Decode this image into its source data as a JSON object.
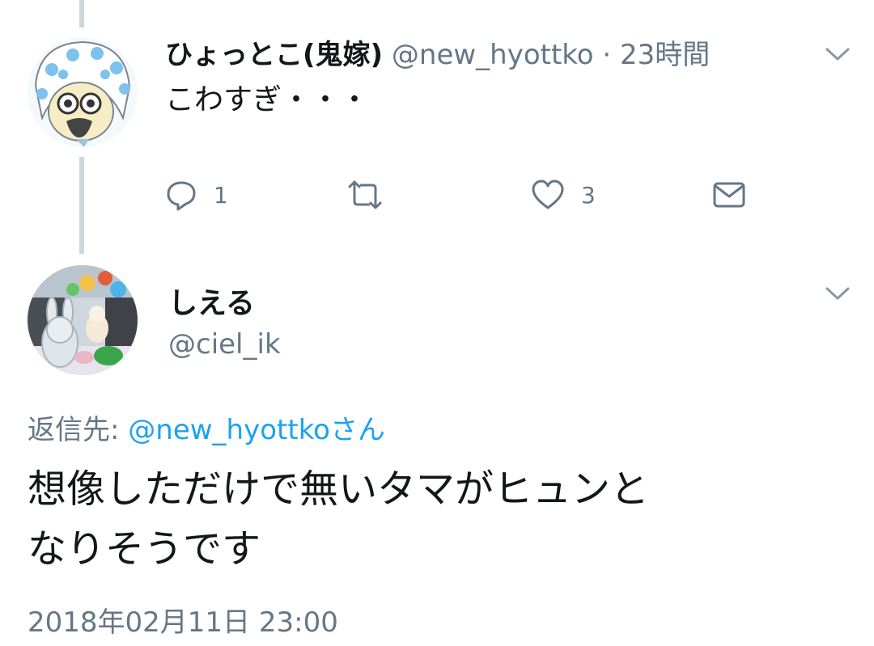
{
  "thread": {
    "parent": {
      "display_name": "ひょっとこ(鬼嫁)",
      "handle": "@new_hyottko",
      "separator": "·",
      "time": "23時間",
      "text": "こわすぎ・・・",
      "reply_count": "1",
      "like_count": "3"
    },
    "reply": {
      "display_name": "しえる",
      "handle": "@ciel_ik",
      "replying_to_prefix": "返信先:",
      "replying_to_handle": "@new_hyottkoさん",
      "text_line1": "想像しただけで無いタマがヒュンと",
      "text_line2": "なりそうです",
      "timestamp": "2018年02月11日 23:00"
    }
  },
  "icons": {
    "reply": "reply-icon",
    "retweet": "retweet-icon",
    "like": "heart-icon",
    "dm": "envelope-icon",
    "menu": "chevron-down-icon"
  },
  "colors": {
    "accent": "#1da1f2",
    "muted": "#657786",
    "thread_line": "#ccd6dd"
  }
}
